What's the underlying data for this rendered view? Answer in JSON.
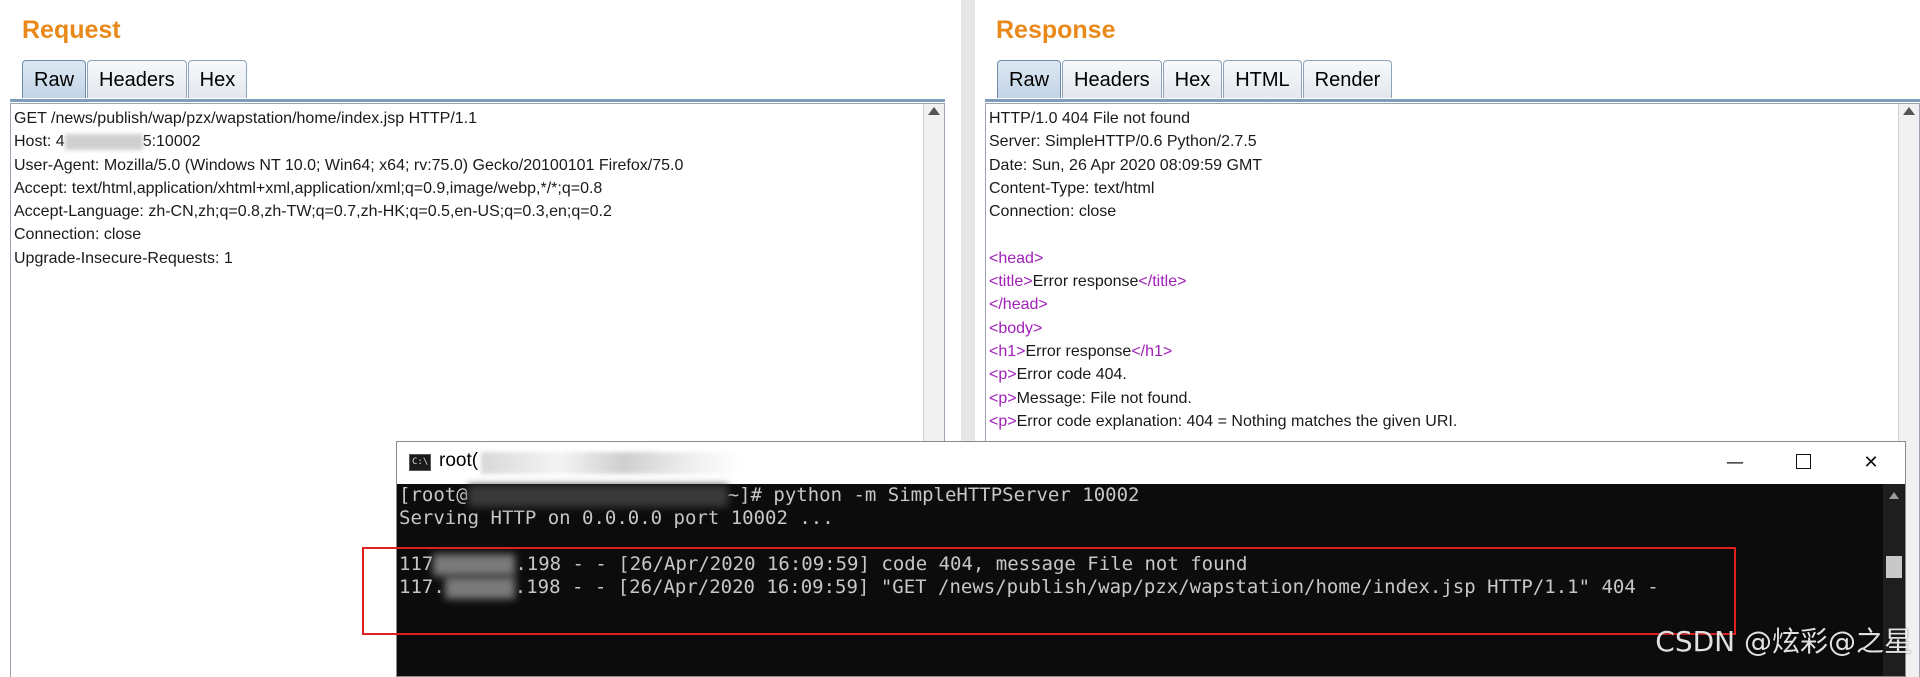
{
  "request": {
    "title": "Request",
    "tabs": [
      {
        "label": "Raw",
        "active": true
      },
      {
        "label": "Headers"
      },
      {
        "label": "Hex"
      }
    ],
    "lines": {
      "l0": "GET /news/publish/wap/pzx/wapstation/home/index.jsp HTTP/1.1",
      "l1a": "Host: 4",
      "l1b": "5:10002",
      "l2": "User-Agent: Mozilla/5.0 (Windows NT 10.0; Win64; x64; rv:75.0) Gecko/20100101 Firefox/75.0",
      "l3": "Accept: text/html,application/xhtml+xml,application/xml;q=0.9,image/webp,*/*;q=0.8",
      "l4": "Accept-Language: zh-CN,zh;q=0.8,zh-TW;q=0.7,zh-HK;q=0.5,en-US;q=0.3,en;q=0.2",
      "l5": "Connection: close",
      "l6": "Upgrade-Insecure-Requests: 1"
    }
  },
  "response": {
    "title": "Response",
    "tabs": [
      {
        "label": "Raw",
        "active": true
      },
      {
        "label": "Headers"
      },
      {
        "label": "Hex"
      },
      {
        "label": "HTML"
      },
      {
        "label": "Render"
      }
    ],
    "lines": {
      "l0": "HTTP/1.0 404 File not found",
      "l1": "Server: SimpleHTTP/0.6 Python/2.7.5",
      "l2": "Date: Sun, 26 Apr 2020 08:09:59 GMT",
      "l3": "Content-Type: text/html",
      "l4": "Connection: close",
      "head_open": "<head>",
      "title_open": "<title>",
      "title_text": "Error response",
      "title_close": "</title>",
      "head_close": "</head>",
      "body_open": "<body>",
      "h1_open": "<h1>",
      "h1_text": "Error response",
      "h1_close": "</h1>",
      "p_open": "<p>",
      "p1_text": "Error code 404.",
      "p2_text": "Message: File not found.",
      "p3_text": "Error code explanation: 404 = Nothing matches the given URI."
    }
  },
  "console": {
    "title": "root(",
    "icon_text": "C:\\",
    "lines": {
      "c0a": "[root@",
      "c0b": "~]# python -m SimpleHTTPServer 10002",
      "c1": "Serving HTTP on 0.0.0.0 port 10002 ...",
      "c3a": "117",
      "c3b": ".198 - - [26/Apr/2020 16:09:59] code 404, message File not found",
      "c4a": "117.",
      "c4b": ".198 - - [26/Apr/2020 16:09:59] \"GET /news/publish/wap/pzx/wapstation/home/index.jsp HTTP/1.1\" 404 -"
    },
    "buttons": {
      "minimize": "—",
      "close": "✕"
    }
  },
  "watermark": "CSDN @炫彩@之星",
  "colors": {
    "title": "#e8891a",
    "tag": "#a020b8",
    "highlight": "#e02020"
  }
}
